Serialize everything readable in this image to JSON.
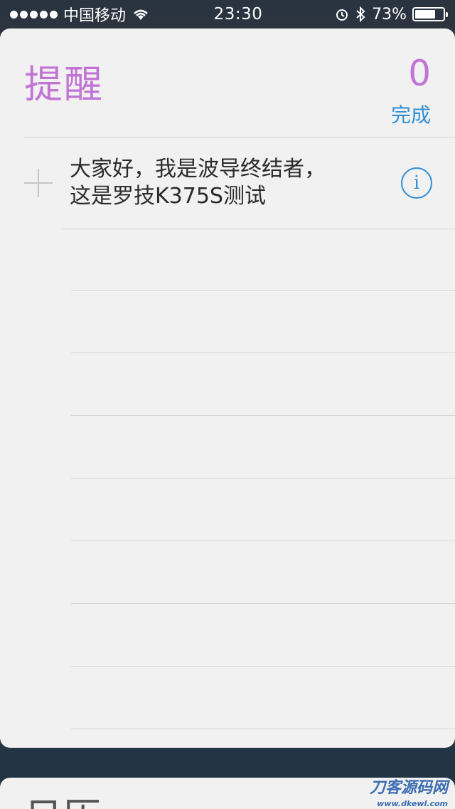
{
  "status_bar": {
    "carrier": "中国移动",
    "time": "23:30",
    "battery": "73%",
    "battery_level": 0.73,
    "icons": [
      "signal-dots",
      "wifi-icon",
      "alarm-icon",
      "bluetooth-icon",
      "battery-icon"
    ]
  },
  "widget": {
    "title": "提醒",
    "count": "0",
    "done_label": "完成",
    "reminder_text": "大家好，我是波导终结者，\n这是罗技K375S测试",
    "info_symbol": "i",
    "plus_icon": "plus-icon"
  },
  "next_widget": {
    "title_partial": "日历"
  },
  "watermark": {
    "brand": "刀客源码网",
    "url": "www.dkewl.com"
  },
  "colors": {
    "title_purple": "#c273d6",
    "link_blue": "#2f8fd4"
  }
}
